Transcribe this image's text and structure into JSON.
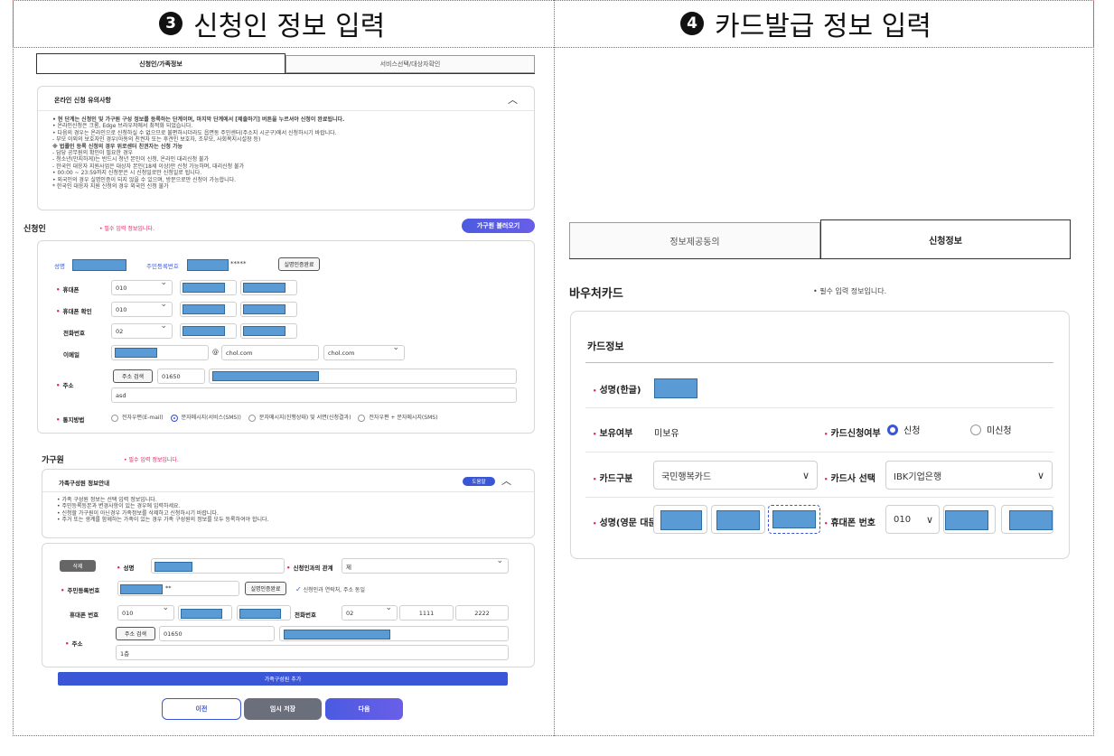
{
  "headings": {
    "left_num": "❸",
    "left_title": "신청인 정보 입력",
    "right_num": "❹",
    "right_title": "카드발급 정보 입력"
  },
  "left": {
    "tabs": [
      "신청인/가족정보",
      "서비스선택/대상자확인"
    ],
    "notice": {
      "title": "온라인 신청 유의사항",
      "lines": [
        "• 현 단계는 신청인 및 가구원 구성 정보를 등록하는 단계이며, 마지막 단계에서 [제출하기] 버튼을 누르셔야 신청이 완료됩니다.",
        "• 온라인신청은 크롬, Edge 브라우저에서 최적화 되었습니다.",
        "• 다음의 경우는 온라인으로 신청하실 수 없으므로 불편하시더라도 읍면동 주민센터(주소지 시군구)에서 신청하시기 바랍니다.",
        "  - 부모 이외의 보호자인 경우(아동의 친권자 또는 후견인 보호자, 조부모, 사회복지시설장 등)",
        "    ※ 법률인 등록 신청의 경우 위로센터 친권자는 신청 가능",
        "  - 담당 공무원의 확인이 필요한 경우",
        "  - 청소년(만지하게)는 반드시 청년 본인이 신청, 온라인 대리신청 불가",
        "  - 한국인 대응자 지원사업은 대상자 본인(18세 이상)만 신청 가능하며, 대리신청 불가",
        "• 00:00 ~ 23:59까지 신청분은 시 신청일로만 신청일로 됩니다.",
        "• 외국인의 경우 실명인증이 되지 않을 수 있으며, 방문으로만 신청이 가능합니다.",
        "  * 한국인 대응자 지원 신청의 경우 외국인 신청 불가"
      ]
    },
    "applicant": {
      "title": "신청인",
      "required_note": "• 필수 입력 정보입니다.",
      "load_family_btn": "가구원 불러오기",
      "name_label": "성명",
      "rrn_label": "주민등록번호",
      "rrn_tail": "*****",
      "verify_btn": "실명인증완료",
      "mobile_label": "휴대폰",
      "mobile_prefix": "010",
      "mobile_confirm_label": "휴대폰 확인",
      "mobile_confirm_prefix": "010",
      "phone_label": "전화번호",
      "phone_prefix": "02",
      "email_label": "이메일",
      "email_at": "@",
      "email_domain": "chol.com",
      "email_domain_select": "chol.com",
      "address_label": "주소",
      "address_search_btn": "주소 검색",
      "zipcode": "01650",
      "address_detail": "asd",
      "notify_label": "통지방법",
      "notify_options": [
        "전자우편(E-mail)",
        "문자메시지(서비스(SMS))",
        "문자메시지(진행상태) 및 서면(신청결과)",
        "전자우편 + 문자메시지(SMS)"
      ]
    },
    "family": {
      "title": "가구원",
      "required_note": "• 필수 입력 정보입니다.",
      "info_title": "가족구성원 정보안내",
      "info_badge": "도움말",
      "info_lines": [
        "• 가족 구성원 정보는 선택 입력 정보입니다.",
        "• 주민등록등본과 변경사항이 있는 경우에 입력하세요.",
        "• 신청할 가구원이 아닌경우 가족정보를 삭제하고 신청하시기 바랍니다.",
        "• 주거 또는 생계를 함께하는 가족이 있는 경우 가족 구성원의 정보를 모두 등록하여야 합니다."
      ],
      "delete_btn": "삭제",
      "name_label": "성명",
      "relation_label": "신청인과의 관계",
      "relation_value": "제",
      "rrn_label": "주민등록번호",
      "rrn_tail": "**",
      "verify_btn": "실명인증완료",
      "same_contact": "신청인과 연락처, 주소 동일",
      "mobile_label": "휴대폰 번호",
      "mobile_prefix": "010",
      "phone_label": "전화번호",
      "phone_prefix": "02",
      "phone_mid": "1111",
      "phone_last": "2222",
      "address_label": "주소",
      "address_search_btn": "주소 검색",
      "zipcode": "01650",
      "address_detail": "1층",
      "add_member_btn": "가족구성원 추가"
    },
    "footer": {
      "prev": "이전",
      "temp_save": "임시 저장",
      "next": "다음"
    }
  },
  "right": {
    "tabs": [
      "정보제공동의",
      "신청정보"
    ],
    "section_title": "바우처카드",
    "required_note": "• 필수 입력 정보입니다.",
    "card_info_title": "카드정보",
    "name_kr_label": "성명(한글)",
    "own_label": "보유여부",
    "own_value": "미보유",
    "apply_label": "카드신청여부",
    "apply_yes": "신청",
    "apply_no": "미신청",
    "card_type_label": "카드구분",
    "card_type_value": "국민행복카드",
    "card_company_label": "카드사 선택",
    "card_company_value": "IBK기업은행",
    "name_en_label": "성명(영문 대문자)",
    "mobile_label": "휴대폰 번호",
    "mobile_prefix": "010"
  }
}
